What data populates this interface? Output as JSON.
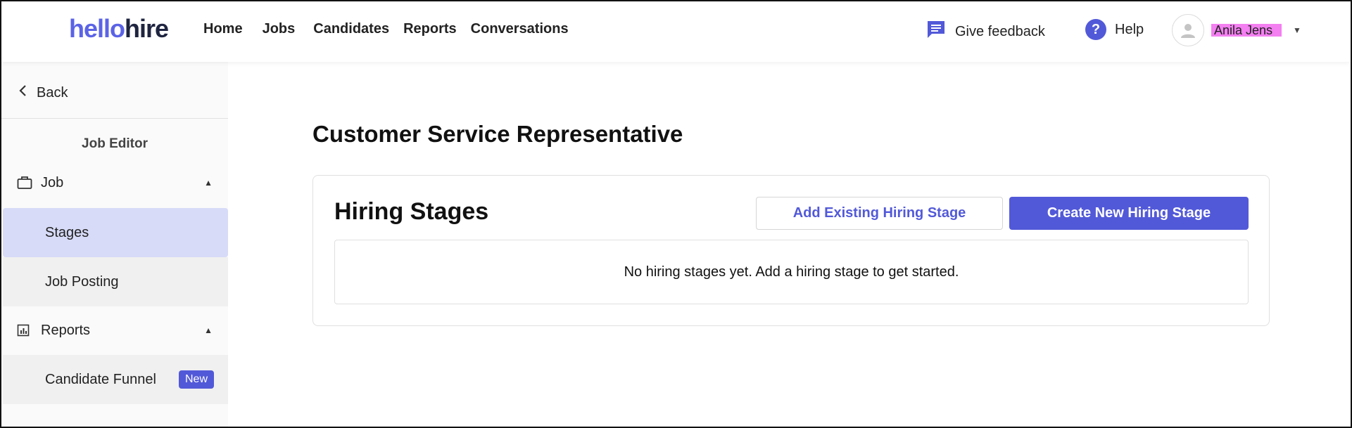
{
  "brand": {
    "logo_part1": "hello",
    "logo_part2": "hire"
  },
  "nav": {
    "home": "Home",
    "jobs": "Jobs",
    "candidates": "Candidates",
    "reports": "Reports",
    "conversations": "Conversations"
  },
  "header": {
    "feedback_label": "Give feedback",
    "help_label": "Help",
    "user_name": "Anila Jens"
  },
  "sidebar": {
    "back_label": "Back",
    "title": "Job Editor",
    "groups": [
      {
        "label": "Job",
        "icon": "briefcase-icon",
        "items": [
          {
            "label": "Stages",
            "active": true
          },
          {
            "label": "Job Posting"
          }
        ]
      },
      {
        "label": "Reports",
        "icon": "bar-chart-icon",
        "items": [
          {
            "label": "Candidate Funnel",
            "badge": "New"
          }
        ]
      }
    ]
  },
  "main": {
    "page_title": "Customer Service Representative",
    "section_title": "Hiring Stages",
    "add_existing_label": "Add Existing Hiring Stage",
    "create_new_label": "Create New Hiring Stage",
    "empty_message": "No hiring stages yet. Add a hiring stage to get started."
  },
  "colors": {
    "accent": "#5259d8",
    "active_bg": "#d7dbf8"
  }
}
